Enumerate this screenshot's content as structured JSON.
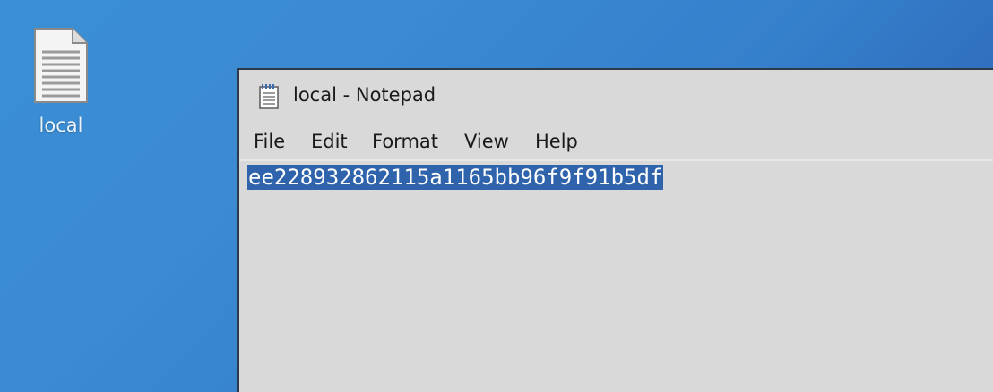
{
  "desktop": {
    "file_icon": {
      "icon": "text-file-icon",
      "label": "local"
    }
  },
  "window": {
    "title": "local - Notepad",
    "icon": "notepad-icon",
    "menu": {
      "file": "File",
      "edit": "Edit",
      "format": "Format",
      "view": "View",
      "help": "Help"
    },
    "document": {
      "selected_text": "ee228932862115a1165bb96f9f91b5df"
    }
  },
  "colors": {
    "desktop_background": "#3a8fd4",
    "window_background": "#d9d9d9",
    "selection": "#2f64ac"
  }
}
